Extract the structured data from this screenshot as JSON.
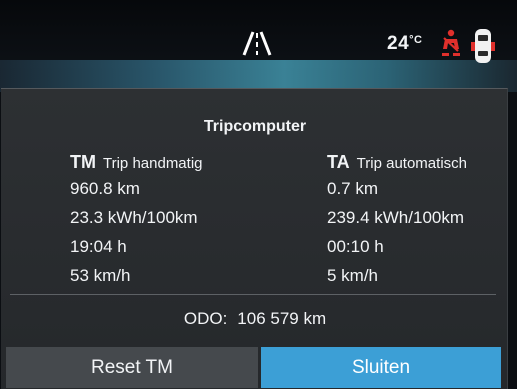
{
  "status": {
    "temperature_value": "24",
    "temperature_unit": "°C",
    "icons": [
      "lane-assist-icon",
      "seatbelt-warning-icon",
      "car-doors-icon"
    ],
    "warning_color": "#e0302c"
  },
  "dialog": {
    "title": "Tripcomputer",
    "trips": [
      {
        "abbr": "TM",
        "name": "Trip handmatig",
        "distance": "960.8 km",
        "consumption": "23.3 kWh/100km",
        "time": "19:04 h",
        "speed": "53 km/h"
      },
      {
        "abbr": "TA",
        "name": "Trip automatisch",
        "distance": "0.7 km",
        "consumption": "239.4 kWh/100km",
        "time": "00:10 h",
        "speed": "5 km/h"
      }
    ],
    "odo_label": "ODO:",
    "odo_value": "106 579 km",
    "reset_label": "Reset TM",
    "close_label": "Sluiten",
    "accent_color": "#3c9fd6"
  }
}
